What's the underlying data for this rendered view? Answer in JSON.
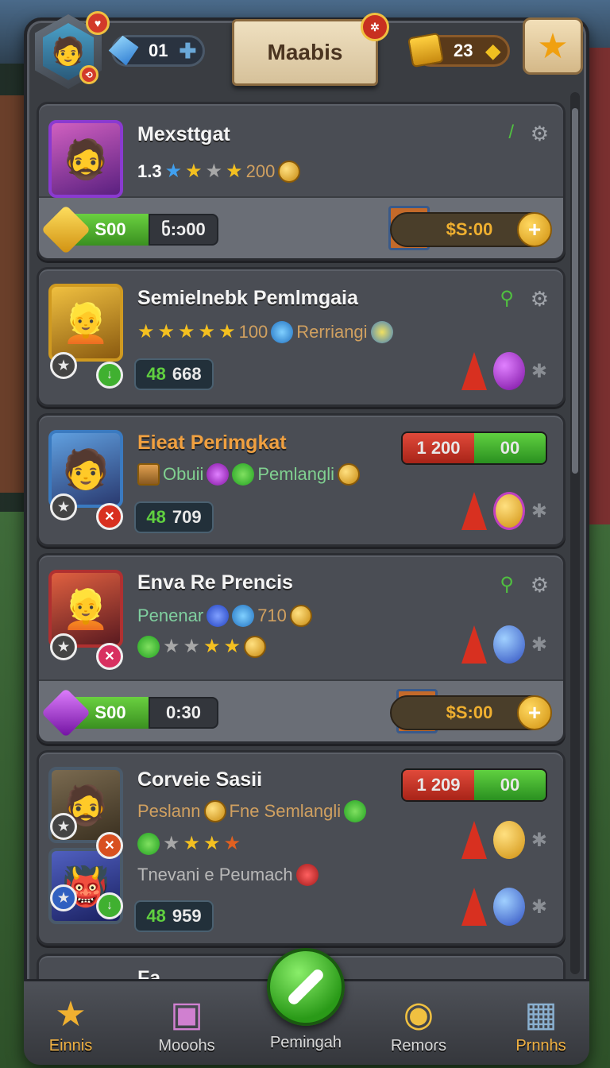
{
  "header": {
    "gems": "01",
    "title": "Maabis",
    "gold": "23"
  },
  "cards": [
    {
      "name": "Mexsttgat",
      "rating": "1.3",
      "score": "200",
      "cost_left": "S00",
      "timer": "ნ:ɔ00",
      "buy_price": "$S:00"
    },
    {
      "name": "Semielnebk Pemlmgaia",
      "score": "100",
      "tag": "Rerriangi",
      "counter_a": "48",
      "counter_b": "668"
    },
    {
      "name": "Eieat Perimgkat",
      "item_a": "Obuii",
      "item_b": "Pemlangli",
      "counter_a": "48",
      "counter_b": "709",
      "red_val": "1 200",
      "green_val": "00"
    },
    {
      "name": "Enva Re Prencis",
      "label": "Penenar",
      "score": "710",
      "cost_left": "S00",
      "timer": "0:30",
      "buy_price": "$S:00"
    },
    {
      "name": "Corveie Sasii",
      "item_a": "Peslann",
      "item_b": "Fne Semlangli",
      "line3": "Tnevani e Peumach",
      "counter_a": "48",
      "counter_b": "959",
      "red_val": "1 209",
      "green_val": "00"
    },
    {
      "name": "Fa...",
      "partial": true
    }
  ],
  "nav": [
    {
      "label": "Einnis",
      "icon": "star-icon"
    },
    {
      "label": "Mooohs",
      "icon": "picture-icon"
    },
    {
      "label": "Pemingah",
      "icon": "play-icon"
    },
    {
      "label": "Remoɾs",
      "icon": "coins-icon"
    },
    {
      "label": "Prnnhs",
      "icon": "monitor-icon"
    }
  ],
  "colors": {
    "accent_green": "#3a9a20",
    "accent_red": "#c83020",
    "gold": "#f0b030",
    "panel": "#4a4d54"
  }
}
